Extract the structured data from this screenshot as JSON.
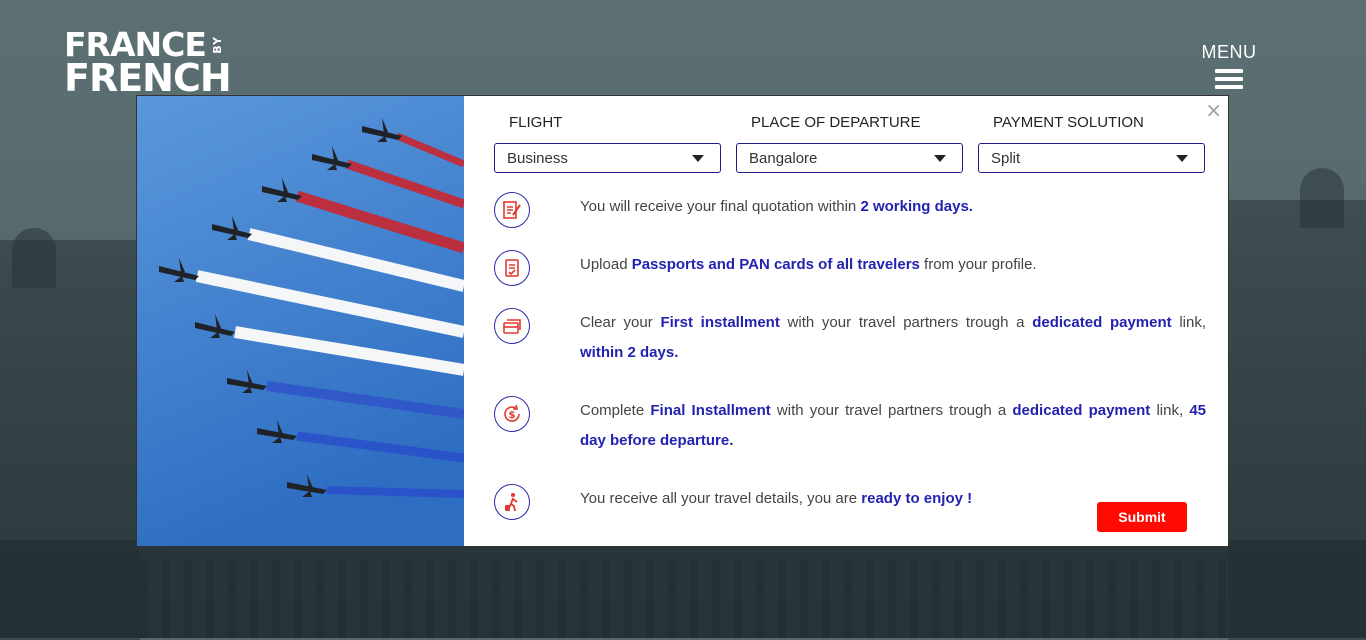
{
  "brand": {
    "line1": "FRANCE",
    "by": "BY",
    "line2": "FRENCH"
  },
  "menu": {
    "label": "MENU"
  },
  "modal": {
    "close_label": "×",
    "fields": [
      {
        "label": "FLIGHT",
        "value": "Business"
      },
      {
        "label": "PLACE OF DEPARTURE",
        "value": "Bangalore"
      },
      {
        "label": "PAYMENT SOLUTION",
        "value": "Split"
      }
    ],
    "steps": [
      {
        "icon": "quotation-icon",
        "parts": [
          "You will receive your final quotation within ",
          "2 working days."
        ]
      },
      {
        "icon": "documents-icon",
        "parts": [
          "Upload ",
          "Passports and PAN cards of all travelers",
          " from your profile."
        ]
      },
      {
        "icon": "payment-cards-icon",
        "parts": [
          "Clear your ",
          "First installment",
          " with your travel partners trough a ",
          "dedicated payment",
          " link, ",
          "within 2 days."
        ]
      },
      {
        "icon": "dollar-refresh-icon",
        "parts": [
          "Complete ",
          "Final Installment",
          " with your travel partners trough a ",
          "dedicated payment",
          " link, ",
          "45 day before departure."
        ]
      },
      {
        "icon": "traveler-luggage-icon",
        "parts": [
          "You receive all your travel details, you are ",
          "ready to enjoy !"
        ]
      }
    ],
    "submit_label": "Submit"
  },
  "colors": {
    "accent": "#2323b0",
    "submit": "#ff0a00",
    "overlay": "#55676c"
  }
}
